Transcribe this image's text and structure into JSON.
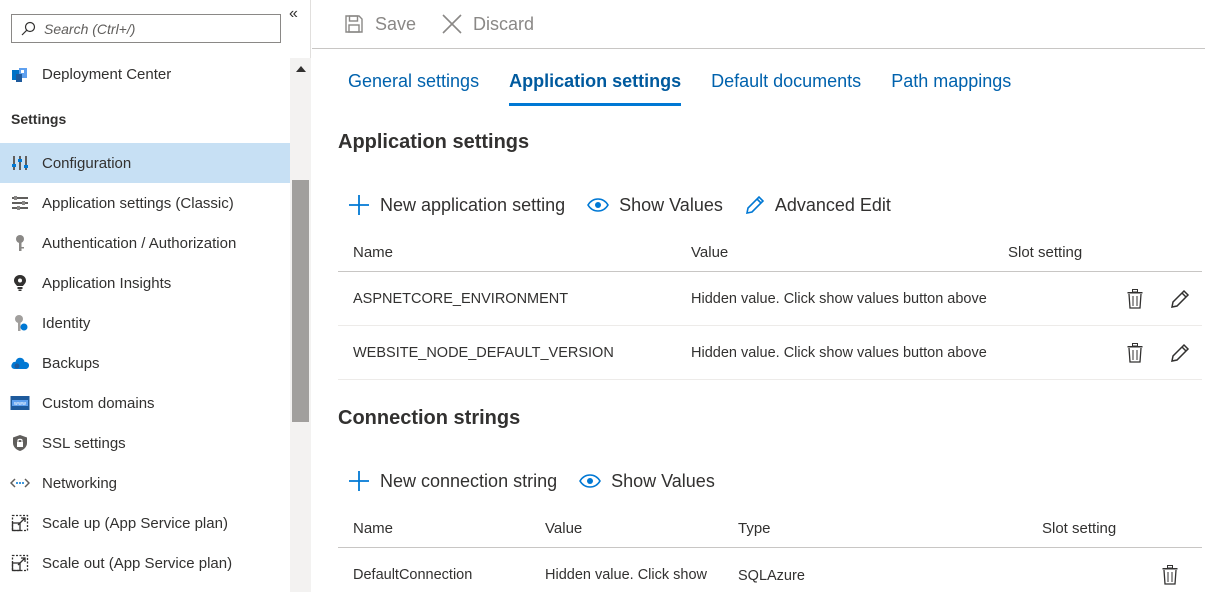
{
  "sidebar": {
    "search_placeholder": "Search (Ctrl+/)",
    "collapse_glyph": "«",
    "items_top": [
      {
        "label": "Deployment Center",
        "icon": "deployment-center-icon"
      }
    ],
    "section_heading": "Settings",
    "items": [
      {
        "label": "Configuration",
        "icon": "configuration-icon",
        "selected": true
      },
      {
        "label": "Application settings (Classic)",
        "icon": "app-settings-classic-icon"
      },
      {
        "label": "Authentication / Authorization",
        "icon": "key-icon"
      },
      {
        "label": "Application Insights",
        "icon": "lightbulb-icon"
      },
      {
        "label": "Identity",
        "icon": "identity-key-icon"
      },
      {
        "label": "Backups",
        "icon": "cloud-icon"
      },
      {
        "label": "Custom domains",
        "icon": "www-icon"
      },
      {
        "label": "SSL settings",
        "icon": "shield-icon"
      },
      {
        "label": "Networking",
        "icon": "networking-icon"
      },
      {
        "label": "Scale up (App Service plan)",
        "icon": "scale-up-icon"
      },
      {
        "label": "Scale out (App Service plan)",
        "icon": "scale-out-icon"
      }
    ]
  },
  "toolbar": {
    "save_label": "Save",
    "discard_label": "Discard"
  },
  "tabs": [
    {
      "label": "General settings",
      "active": false
    },
    {
      "label": "Application settings",
      "active": true
    },
    {
      "label": "Default documents",
      "active": false
    },
    {
      "label": "Path mappings",
      "active": false
    }
  ],
  "app_settings": {
    "title": "Application settings",
    "new_label": "New application setting",
    "show_values_label": "Show Values",
    "advanced_edit_label": "Advanced Edit",
    "columns": {
      "name": "Name",
      "value": "Value",
      "slot": "Slot setting"
    },
    "rows": [
      {
        "name": "ASPNETCORE_ENVIRONMENT",
        "value": "Hidden value. Click show values button above"
      },
      {
        "name": "WEBSITE_NODE_DEFAULT_VERSION",
        "value": "Hidden value. Click show values button above"
      }
    ]
  },
  "conn_strings": {
    "title": "Connection strings",
    "new_label": "New connection string",
    "show_values_label": "Show Values",
    "columns": {
      "name": "Name",
      "value": "Value",
      "type": "Type",
      "slot": "Slot setting"
    },
    "rows": [
      {
        "name": "DefaultConnection",
        "value": "Hidden value. Click show",
        "type": "SQLAzure"
      }
    ]
  },
  "colors": {
    "accent": "#0078d4",
    "selected_bg": "#c7e0f4",
    "link": "#0062ad"
  }
}
